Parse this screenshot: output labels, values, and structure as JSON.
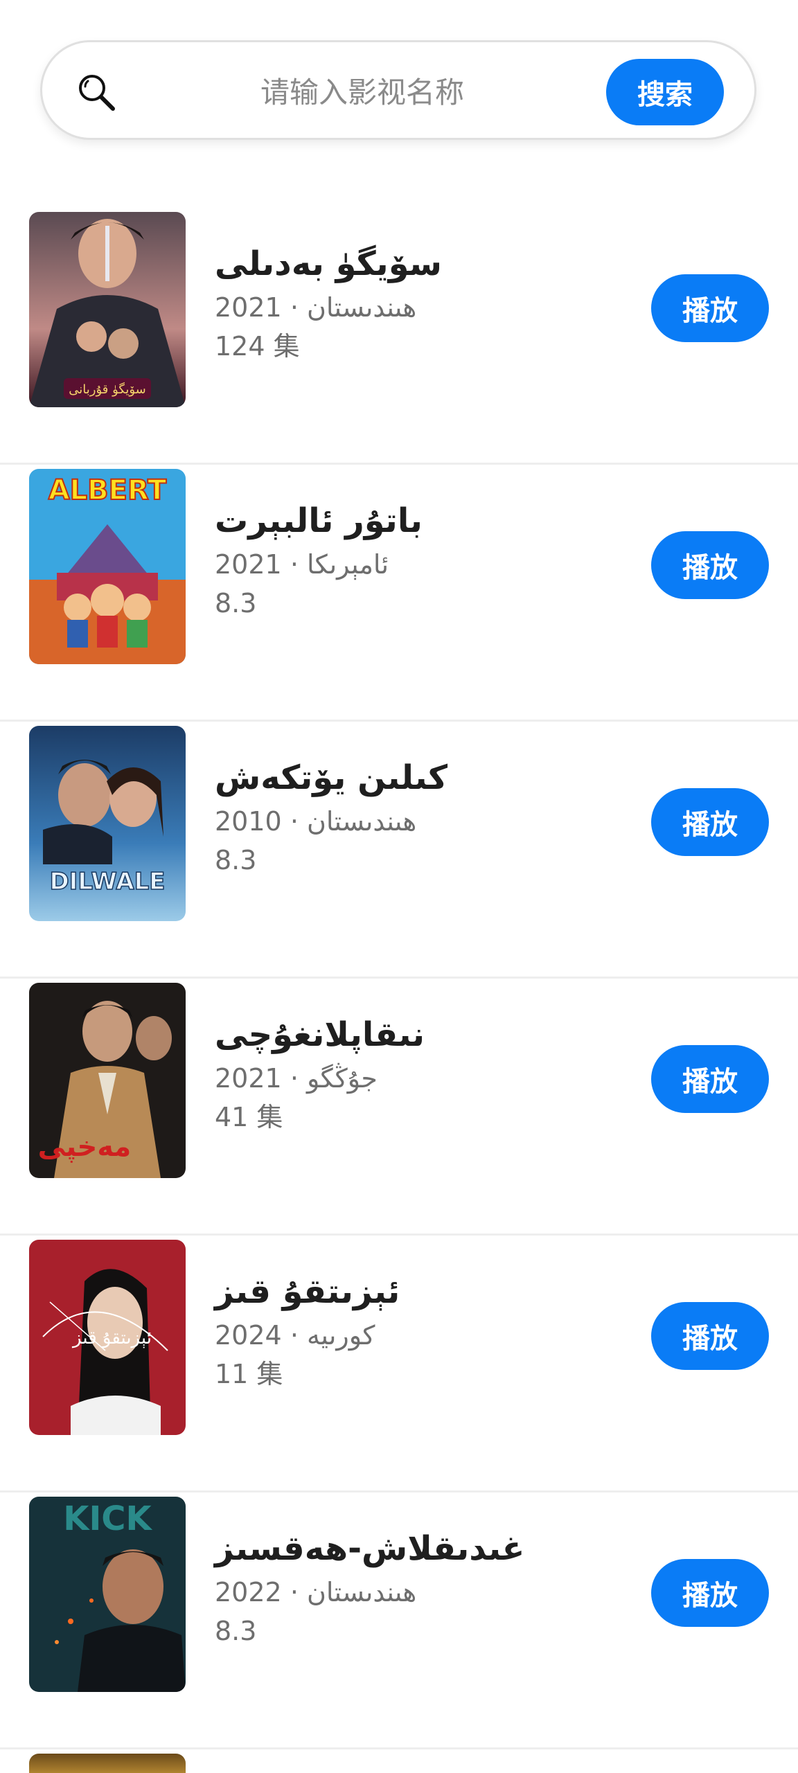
{
  "search": {
    "placeholder": "请输入影视名称",
    "button_label": "搜索",
    "icon": "search-icon"
  },
  "items": [
    {
      "title": "سۆيگۈ بەدىلى",
      "year": "2021",
      "country": "ھىندىستان",
      "extra": "124 集",
      "play_label": "播放",
      "poster_text": "سۆيگۈ قۇربانى"
    },
    {
      "title": "باتۇر ئالبېرت",
      "year": "2021",
      "country": "ئامېرىكا",
      "extra": "8.3",
      "play_label": "播放",
      "poster_text": "ALBERT"
    },
    {
      "title": "كىلىن يۆتكەش",
      "year": "2010",
      "country": "ھىندىستان",
      "extra": "8.3",
      "play_label": "播放",
      "poster_text": "DILWALE"
    },
    {
      "title": "نىقاپلانغۇچى",
      "year": "2021",
      "country": "جۇڭگو",
      "extra": "41 集",
      "play_label": "播放",
      "poster_text": "مەخپى"
    },
    {
      "title": "ئېزىتقۇ قىز",
      "year": "2024",
      "country": "كورىيە",
      "extra": "11 集",
      "play_label": "播放",
      "poster_text": "ئېزىتقۇ قىز"
    },
    {
      "title": "غىدىقلاش-ھەقسىز",
      "year": "2022",
      "country": "ھىندىستان",
      "extra": "8.3",
      "play_label": "播放",
      "poster_text": "KICK"
    }
  ],
  "meta_separator": "·",
  "colors": {
    "accent": "#0a7cf6"
  }
}
